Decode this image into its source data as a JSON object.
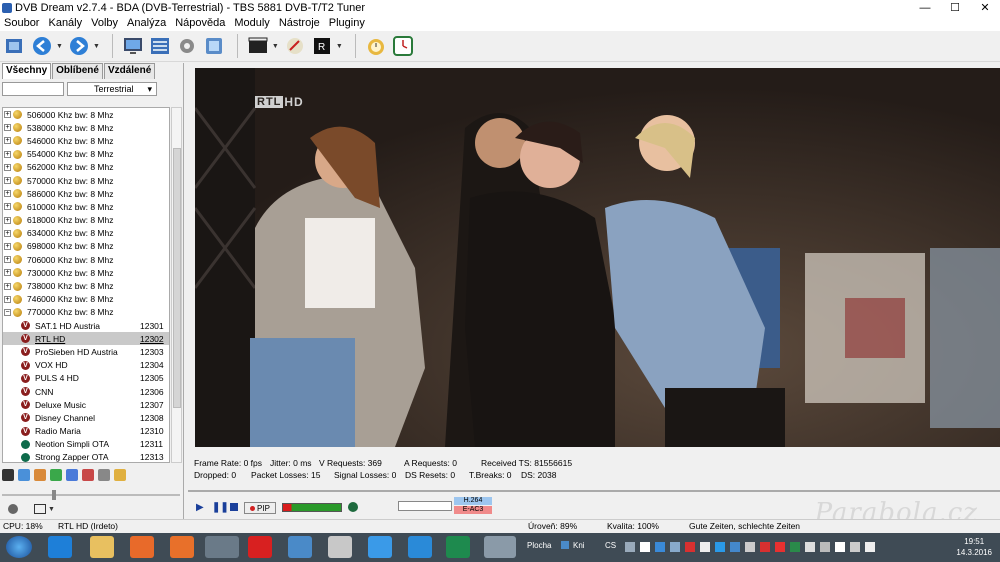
{
  "window": {
    "title": "DVB Dream v2.7.4 - BDA (DVB-Terrestrial)  -  TBS 5881 DVB-T/T2 Tuner",
    "minimize": "—",
    "maximize": "☐",
    "close": "✕"
  },
  "menu": [
    "Soubor",
    "Kanály",
    "Volby",
    "Analýza",
    "Nápověda",
    "Moduly",
    "Nástroje",
    "Pluginy"
  ],
  "left": {
    "tabs": [
      "Všechny",
      "Oblíbené",
      "Vzdálené"
    ],
    "filter_value": "Terrestrial",
    "transponders": [
      "506000 Khz  bw: 8 Mhz",
      "538000 Khz  bw: 8 Mhz",
      "546000 Khz  bw: 8 Mhz",
      "554000 Khz  bw: 8 Mhz",
      "562000 Khz  bw: 8 Mhz",
      "570000 Khz  bw: 8 Mhz",
      "586000 Khz  bw: 8 Mhz",
      "610000 Khz  bw: 8 Mhz",
      "618000 Khz  bw: 8 Mhz",
      "634000 Khz  bw: 8 Mhz",
      "698000 Khz  bw: 8 Mhz",
      "706000 Khz  bw: 8 Mhz",
      "730000 Khz  bw: 8 Mhz",
      "738000 Khz  bw: 8 Mhz",
      "746000 Khz  bw: 8 Mhz",
      "770000 Khz  bw: 8 Mhz"
    ],
    "channels": [
      {
        "name": "SAT.1 HD Austria",
        "num": "12301",
        "icon": "v"
      },
      {
        "name": "RTL HD",
        "num": "12302",
        "icon": "v"
      },
      {
        "name": "ProSieben HD Austria",
        "num": "12303",
        "icon": "v"
      },
      {
        "name": "VOX HD",
        "num": "12304",
        "icon": "v"
      },
      {
        "name": "PULS 4 HD",
        "num": "12305",
        "icon": "v"
      },
      {
        "name": "CNN",
        "num": "12306",
        "icon": "v"
      },
      {
        "name": "Deluxe Music",
        "num": "12307",
        "icon": "v"
      },
      {
        "name": "Disney Channel",
        "num": "12308",
        "icon": "v"
      },
      {
        "name": "Radio Maria",
        "num": "12310",
        "icon": "v"
      },
      {
        "name": "Neotion Simpli OTA",
        "num": "12311",
        "icon": "g"
      },
      {
        "name": "Strong Zapper OTA",
        "num": "12313",
        "icon": "g"
      }
    ],
    "selected_channel": "RTL HD"
  },
  "video": {
    "logo_box": "RTL",
    "logo_suffix": "HD"
  },
  "stats": {
    "frame_rate": "Frame Rate: 0 fps",
    "jitter": "Jitter: 0 ms",
    "v_requests": "V Requests: 369",
    "a_requests": "A Requests: 0",
    "received_ts": "Received TS: 81556615",
    "dropped": "Dropped: 0",
    "packet_losses": "Packet Losses: 15",
    "signal_losses": "Signal Losses: 0",
    "ds_resets": "DS Resets: 0",
    "t_breaks": "T.Breaks: 0",
    "ds": "DS: 2038"
  },
  "transport": {
    "pip": "PIP",
    "video_codec": "H.264",
    "audio_codec": "E-AC3"
  },
  "status": {
    "cpu": "CPU: 18%",
    "channel": "RTL HD (Irdeto)",
    "level": "Úroveň: 89%",
    "quality": "Kvalita: 100%",
    "program": "Gute Zeiten, schlechte Zeiten"
  },
  "watermark": "Parabola.cz",
  "taskbar": {
    "desktop": "Plocha",
    "kni": "Kni",
    "lang": "CS",
    "time": "19:51",
    "date": "14.3.2016"
  }
}
